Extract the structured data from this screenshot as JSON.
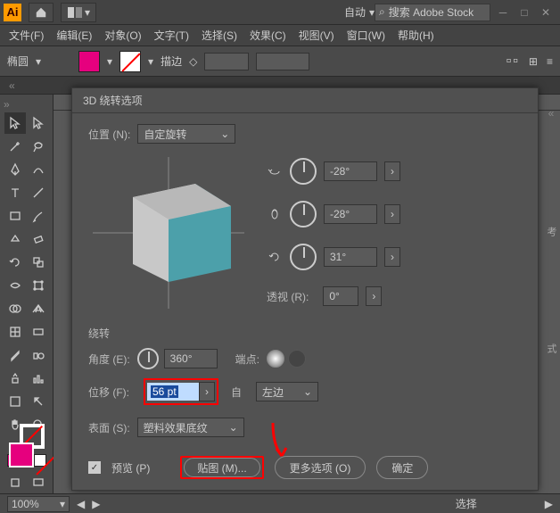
{
  "title": {
    "auto_label": "自动",
    "search_placeholder": "搜索 Adobe Stock"
  },
  "menu": {
    "file": "文件(F)",
    "edit": "编辑(E)",
    "object": "对象(O)",
    "type": "文字(T)",
    "select": "选择(S)",
    "effect": "效果(C)",
    "view": "视图(V)",
    "window": "窗口(W)",
    "help": "帮助(H)"
  },
  "controlbar": {
    "shape": "椭圆",
    "stroke_label": "描边"
  },
  "dialog": {
    "title": "3D 绕转选项",
    "position_label": "位置 (N):",
    "position_value": "自定旋转",
    "rot_x": "-28°",
    "rot_y": "-28°",
    "rot_z": "31°",
    "perspective_label": "透视 (R):",
    "perspective_value": "0°",
    "section_revolve": "绕转",
    "angle_label": "角度 (E):",
    "angle_value": "360°",
    "cap_label": "端点:",
    "offset_label": "位移 (F):",
    "offset_value": "56 pt",
    "offset_from_label": "自",
    "offset_from_value": "左边",
    "surface_label": "表面 (S):",
    "surface_value": "塑料效果底纹",
    "preview_label": "预览 (P)",
    "map_art_label": "贴图 (M)...",
    "more_options_label": "更多选项 (O)",
    "ok_label": "确定"
  },
  "right_tabs": {
    "a": "考",
    "b": "式"
  },
  "statusbar": {
    "zoom": "100%",
    "mode": "选择"
  }
}
